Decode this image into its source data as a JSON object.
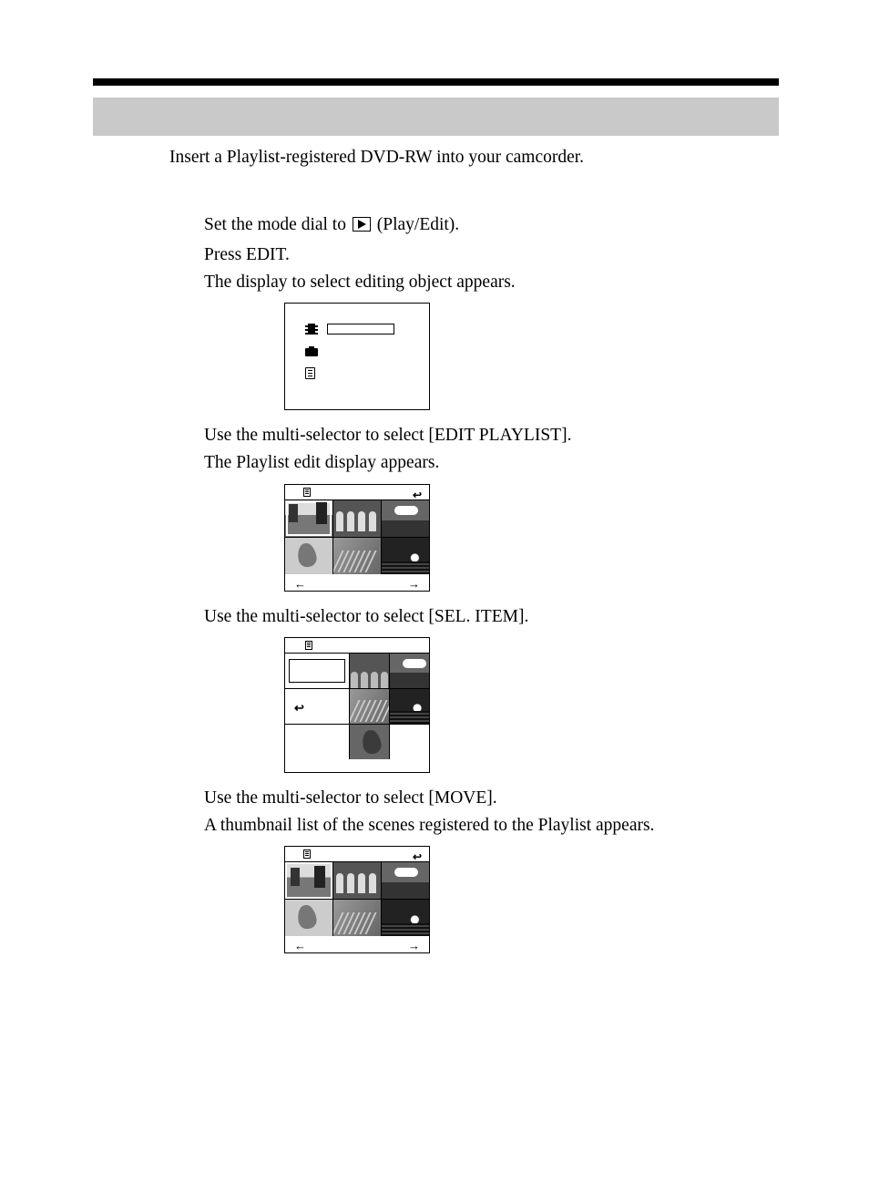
{
  "intro": "Insert a Playlist-registered DVD-RW into your camcorder.",
  "steps": {
    "s1_a": "Set the mode dial to ",
    "s1_b": " (Play/Edit).",
    "s2": "Press EDIT.",
    "s2_sub": "The display to select editing object appears.",
    "s3": "Use the multi-selector to select [EDIT PLAYLIST].",
    "s3_sub": "The Playlist edit display appears.",
    "s4": "Use the multi-selector to select [SEL. ITEM].",
    "s5": "Use the multi-selector to select [MOVE].",
    "s5_sub": "A thumbnail list of the scenes registered to the Playlist appears."
  },
  "icons": {
    "play": "play-icon",
    "film": "film-icon",
    "camera": "camera-icon",
    "playlist": "playlist-icon",
    "return": "↩",
    "left_arrow": "←",
    "right_arrow": "→"
  }
}
